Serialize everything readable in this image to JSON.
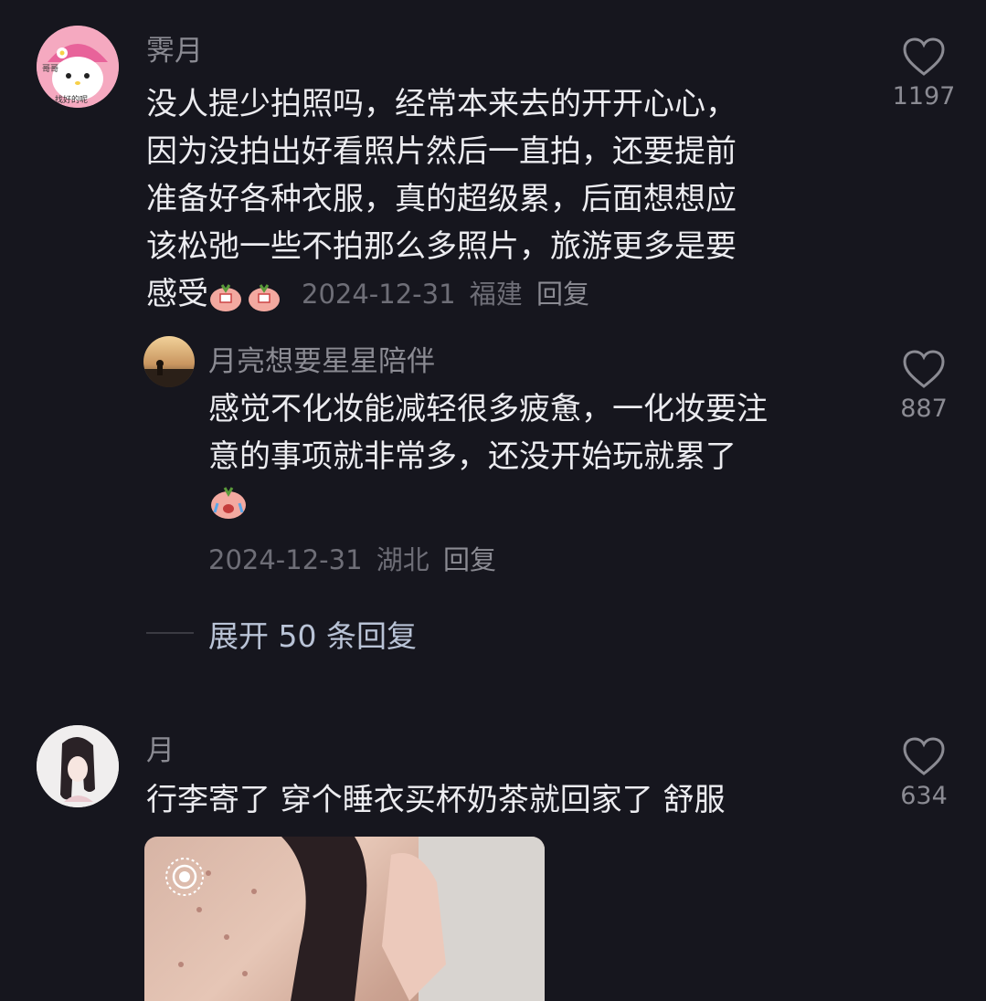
{
  "comments": [
    {
      "username": "霁月",
      "avatar_text_top": "哥哥",
      "avatar_text_bottom": "找好的呢",
      "lines": [
        "没人提少拍照吗，经常本来去的开开心心，",
        "因为没拍出好看照片然后一直拍，还要提前",
        "准备好各种衣服，真的超级累，后面想想应",
        "该松弛一些不拍那么多照片，旅游更多是要",
        "感受"
      ],
      "date": "2024-12-31",
      "location": "福建",
      "reply_label": "回复",
      "likes": "1197",
      "reply": {
        "username": "月亮想要星星陪伴",
        "lines": [
          "感觉不化妆能减轻很多疲惫，一化妆要注",
          "意的事项就非常多，还没开始玩就累了"
        ],
        "date": "2024-12-31",
        "location": "湖北",
        "reply_label": "回复",
        "likes": "887"
      },
      "expand_label": "展开 50 条回复"
    },
    {
      "username": "月",
      "text": "行李寄了 穿个睡衣买杯奶茶就回家了 舒服",
      "likes": "634"
    }
  ],
  "icons": [
    "heart-icon",
    "live-photo-icon"
  ],
  "colors": {
    "background": "#16161e",
    "text": "#ececf0",
    "muted": "#8b8b93",
    "link": "#b9c3d6"
  }
}
